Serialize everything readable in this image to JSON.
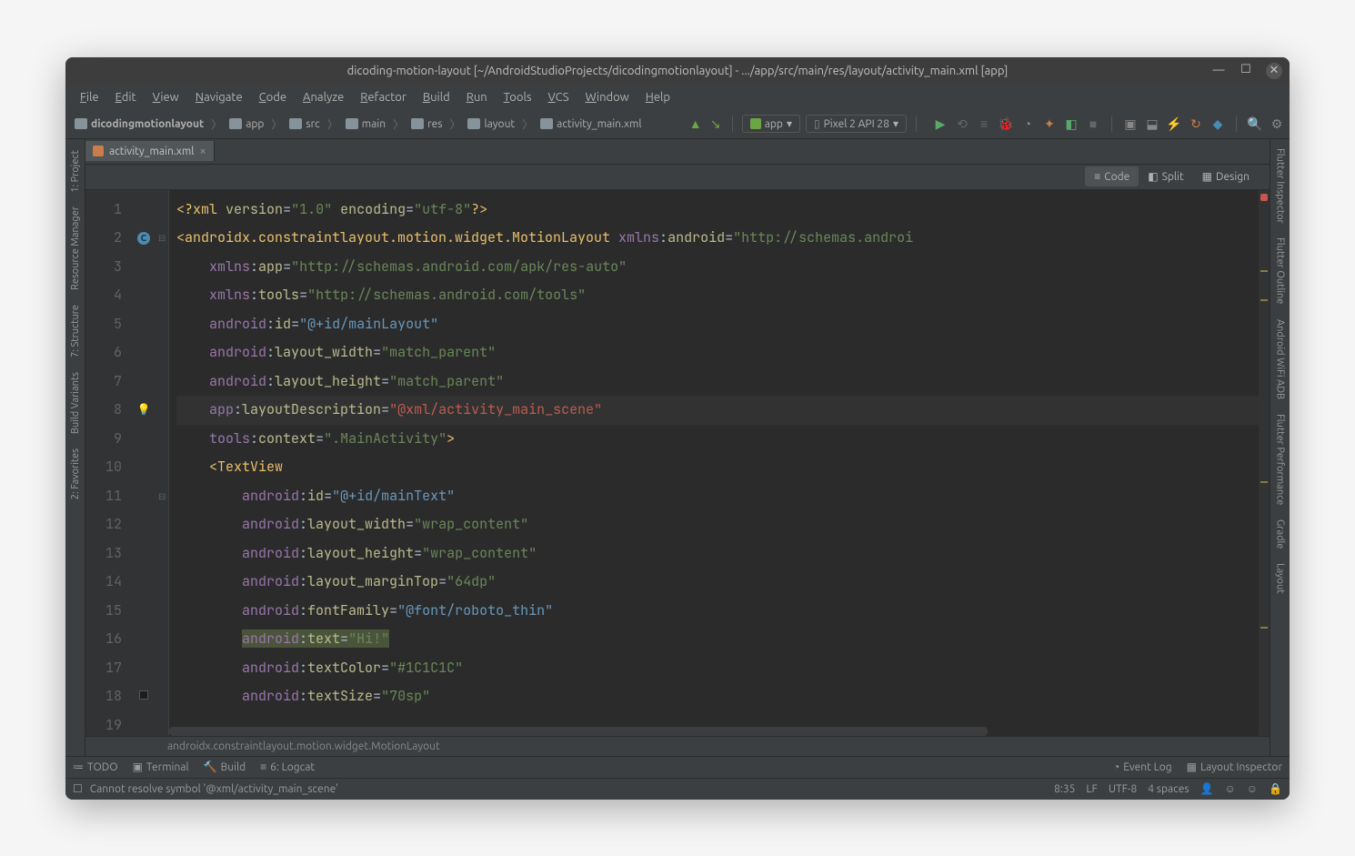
{
  "titlebar": {
    "title": "dicoding-motion-layout [~/AndroidStudioProjects/dicodingmotionlayout] - .../app/src/main/res/layout/activity_main.xml [app]"
  },
  "menubar": [
    "File",
    "Edit",
    "View",
    "Navigate",
    "Code",
    "Analyze",
    "Refactor",
    "Build",
    "Run",
    "Tools",
    "VCS",
    "Window",
    "Help"
  ],
  "breadcrumbs": [
    "dicodingmotionlayout",
    "app",
    "src",
    "main",
    "res",
    "layout",
    "activity_main.xml"
  ],
  "run": {
    "config": "app",
    "device": "Pixel 2 API 28"
  },
  "tab": {
    "name": "activity_main.xml"
  },
  "view_modes": {
    "code": "Code",
    "split": "Split",
    "design": "Design"
  },
  "code": {
    "lines": [
      {
        "n": 1,
        "html": "<span class='c-pi'>&lt;?</span><span class='c-tag'>xml</span> <span class='c-attr-ns'>version</span><span class='c-eq'>=</span><span class='c-str'>\"1.0\"</span> <span class='c-attr-ns'>encoding</span><span class='c-eq'>=</span><span class='c-str'>\"utf-8\"</span><span class='c-pi'>?&gt;</span>"
      },
      {
        "n": 2,
        "icon": "C",
        "fold": "⊟",
        "html": "<span class='c-tag'>&lt;androidx.constraintlayout.motion.widget.MotionLayout</span> <span class='c-attr-pre'>xmlns</span><span class='c-colon'>:</span><span class='c-attr-ns'>android</span><span class='c-eq'>=</span><span class='c-str'>\"http://schemas.androi</span>"
      },
      {
        "n": 3,
        "html": "    <span class='c-attr-pre'>xmlns</span><span class='c-colon'>:</span><span class='c-attr-ns'>app</span><span class='c-eq'>=</span><span class='c-str'>\"http://schemas.android.com/apk/res-auto\"</span>"
      },
      {
        "n": 4,
        "html": "    <span class='c-attr-pre'>xmlns</span><span class='c-colon'>:</span><span class='c-attr-ns'>tools</span><span class='c-eq'>=</span><span class='c-str'>\"http://schemas.android.com/tools\"</span>"
      },
      {
        "n": 5,
        "html": "    <span class='c-attr-pre'>android</span><span class='c-colon'>:</span><span class='c-attr-ns'>id</span><span class='c-eq'>=</span><span class='c-str-ref'>\"@+id/mainLayout\"</span>"
      },
      {
        "n": 6,
        "html": "    <span class='c-attr-pre'>android</span><span class='c-colon'>:</span><span class='c-attr-ns'>layout_width</span><span class='c-eq'>=</span><span class='c-str'>\"match_parent\"</span>"
      },
      {
        "n": 7,
        "html": "    <span class='c-attr-pre'>android</span><span class='c-colon'>:</span><span class='c-attr-ns'>layout_height</span><span class='c-eq'>=</span><span class='c-str'>\"match_parent\"</span>"
      },
      {
        "n": 8,
        "icon": "bulb",
        "hl": true,
        "html": "    <span class='c-attr-pre'>app</span><span class='c-colon'>:</span><span class='c-attr-ns'>layoutDescription</span><span class='c-eq'>=</span><span class='c-str-err'>\"@xml/activity_main_scene\"</span>"
      },
      {
        "n": 9,
        "html": "    <span class='c-attr-pre'>tools</span><span class='c-colon'>:</span><span class='c-attr-ns'>context</span><span class='c-eq'>=</span><span class='c-str'>\".MainActivity\"</span><span class='c-tag'>&gt;</span>"
      },
      {
        "n": 10,
        "html": ""
      },
      {
        "n": 11,
        "fold": "⊟",
        "html": "    <span class='c-tag'>&lt;TextView</span>"
      },
      {
        "n": 12,
        "html": "        <span class='c-attr-pre'>android</span><span class='c-colon'>:</span><span class='c-attr-ns'>id</span><span class='c-eq'>=</span><span class='c-str-ref'>\"@+id/mainText\"</span>"
      },
      {
        "n": 13,
        "html": "        <span class='c-attr-pre'>android</span><span class='c-colon'>:</span><span class='c-attr-ns'>layout_width</span><span class='c-eq'>=</span><span class='c-str'>\"wrap_content\"</span>"
      },
      {
        "n": 14,
        "html": "        <span class='c-attr-pre'>android</span><span class='c-colon'>:</span><span class='c-attr-ns'>layout_height</span><span class='c-eq'>=</span><span class='c-str'>\"wrap_content\"</span>"
      },
      {
        "n": 15,
        "html": "        <span class='c-attr-pre'>android</span><span class='c-colon'>:</span><span class='c-attr-ns'>layout_marginTop</span><span class='c-eq'>=</span><span class='c-str'>\"64dp\"</span>"
      },
      {
        "n": 16,
        "html": "        <span class='c-attr-pre'>android</span><span class='c-colon'>:</span><span class='c-attr-ns'>fontFamily</span><span class='c-eq'>=</span><span class='c-str-ref'>\"@font/roboto_thin\"</span>"
      },
      {
        "n": 17,
        "html": "        <span class='text-sel'><span class='c-attr-pre'>android</span><span class='c-colon'>:</span><span class='c-attr-ns'>text</span><span class='c-eq'>=</span><span class='c-str'>\"Hi!\"</span></span>"
      },
      {
        "n": 18,
        "icon": "bp",
        "html": "        <span class='c-attr-pre'>android</span><span class='c-colon'>:</span><span class='c-attr-ns'>textColor</span><span class='c-eq'>=</span><span class='c-str'>\"#1C1C1C\"</span>"
      },
      {
        "n": 19,
        "html": "        <span class='c-attr-pre'>android</span><span class='c-colon'>:</span><span class='c-attr-ns'>textSize</span><span class='c-eq'>=</span><span class='c-str'>\"70sp\"</span>"
      }
    ]
  },
  "breadcrumb_path": "androidx.constraintlayout.motion.widget.MotionLayout",
  "left_panels": [
    "1: Project",
    "Resource Manager",
    "7: Structure",
    "Build Variants",
    "2: Favorites"
  ],
  "right_panels": [
    "Flutter Inspector",
    "Flutter Outline",
    "Android WiFi ADB",
    "Flutter Performance",
    "Gradle",
    "Layout"
  ],
  "bottom_tabs": {
    "left": [
      "TODO",
      "Terminal",
      "Build",
      "6: Logcat"
    ],
    "right": [
      "Event Log",
      "Layout Inspector"
    ]
  },
  "statusbar": {
    "message": "Cannot resolve symbol '@xml/activity_main_scene'",
    "cursor": "8:35",
    "lineend": "LF",
    "encoding": "UTF-8",
    "indent": "4 spaces"
  }
}
